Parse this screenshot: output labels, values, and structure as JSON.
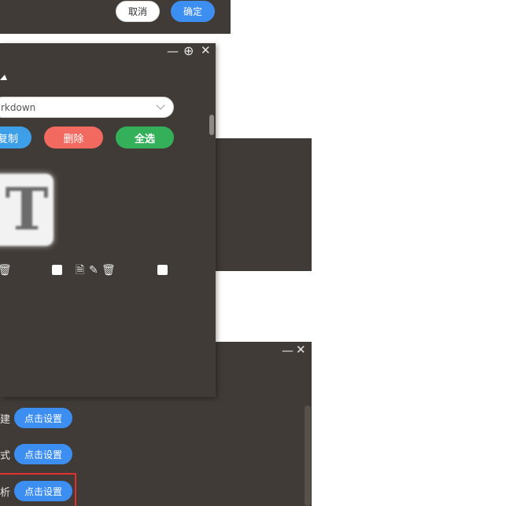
{
  "top_dialog": {
    "cancel_label": "取消",
    "ok_label": "确定"
  },
  "main_window": {
    "controls": {
      "minimize": "—",
      "add": "⊕",
      "close": "✕"
    },
    "select": {
      "value": "rkdown"
    },
    "buttons": {
      "copy": "复制",
      "delete": "删除",
      "select_all": "全选"
    },
    "thumb_letter": "T",
    "item_icons": {
      "doc": "🗎",
      "edit": "✎",
      "trash": "🗑"
    }
  },
  "bottom_panel": {
    "controls": {
      "minimize": "—",
      "close": "✕"
    },
    "rows": [
      {
        "label": "建",
        "button": "点击设置"
      },
      {
        "label": "式",
        "button": "点击设置"
      },
      {
        "label": "析",
        "button": "点击设置"
      }
    ]
  },
  "colors": {
    "panel": "#403b36",
    "primary": "#3d8ef1",
    "danger": "#f26a5f",
    "success": "#34b05a",
    "highlight": "#e23030"
  }
}
